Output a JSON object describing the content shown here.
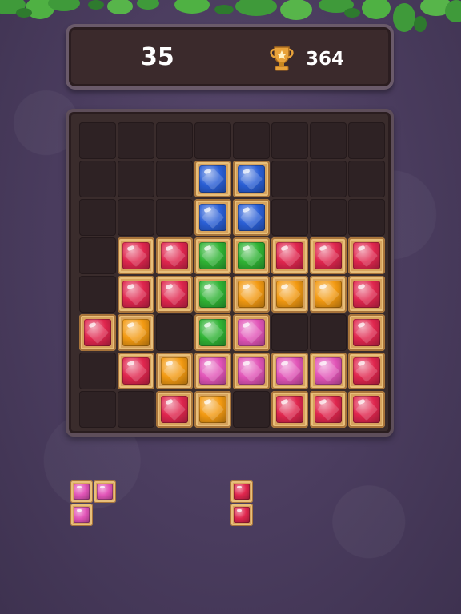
{
  "score": {
    "current": "35",
    "best": "364"
  },
  "icons": {
    "best": "trophy-icon",
    "decoration": "jungle-leaves"
  },
  "colors": {
    "red": "#e0264e",
    "blue": "#2a5fd6",
    "green": "#2fb334",
    "orange": "#f39a12",
    "pink": "#e255b8",
    "frame": "#d7a35d"
  },
  "board": {
    "rows": 8,
    "cols": 8,
    "cells": [
      [
        null,
        null,
        null,
        null,
        null,
        null,
        null,
        null
      ],
      [
        null,
        null,
        null,
        "blue",
        "blue",
        null,
        null,
        null
      ],
      [
        null,
        null,
        null,
        "blue",
        "blue",
        null,
        null,
        null
      ],
      [
        null,
        "red",
        "red",
        "green",
        "green",
        "red",
        "red",
        "red"
      ],
      [
        null,
        "red",
        "red",
        "green",
        "orange",
        "orange",
        "orange",
        "red"
      ],
      [
        "red",
        "orange",
        null,
        "green",
        "pink",
        null,
        null,
        "red"
      ],
      [
        null,
        "red",
        "orange",
        "pink",
        "pink",
        "pink",
        "pink",
        "red"
      ],
      [
        null,
        null,
        "red",
        "orange",
        null,
        "red",
        "red",
        "red"
      ]
    ]
  },
  "pieces": [
    {
      "name": "piece-l-shape",
      "color": "pink",
      "cells": [
        [
          0,
          0
        ],
        [
          0,
          1
        ],
        [
          1,
          0
        ]
      ]
    },
    {
      "name": "piece-vertical-bar",
      "color": "red",
      "cells": [
        [
          0,
          0
        ],
        [
          1,
          0
        ]
      ]
    }
  ]
}
